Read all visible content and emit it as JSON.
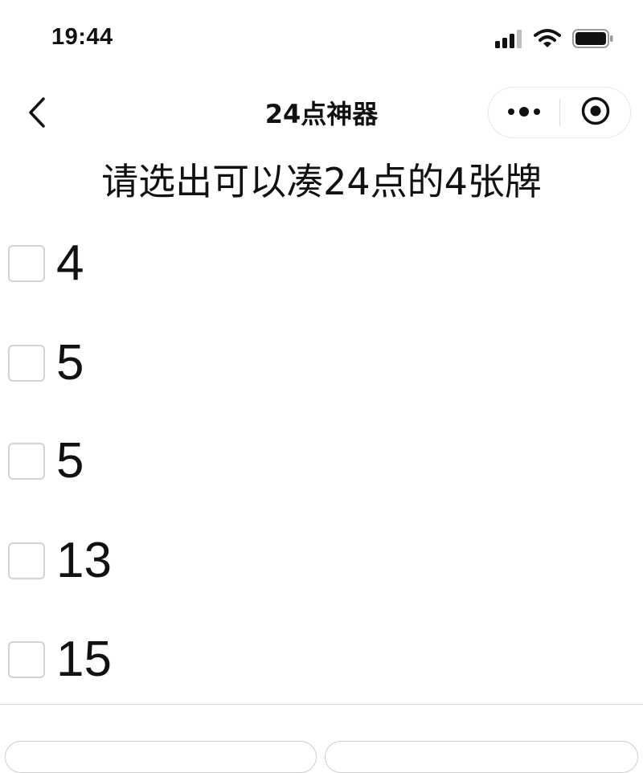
{
  "status_bar": {
    "time": "19:44",
    "icons": [
      "cellular-signal-icon",
      "wifi-icon",
      "battery-icon"
    ]
  },
  "nav": {
    "title": "24点神器",
    "back_icon": "chevron-left-icon",
    "more_icon": "more-dots-icon",
    "close_icon": "target-close-icon"
  },
  "prompt": "请选出可以凑24点的4张牌",
  "cards": [
    {
      "label": "4",
      "checked": false
    },
    {
      "label": "5",
      "checked": false
    },
    {
      "label": "5",
      "checked": false
    },
    {
      "label": "13",
      "checked": false
    },
    {
      "label": "15",
      "checked": false
    }
  ],
  "colors": {
    "background": "#ffffff",
    "text": "#111111",
    "checkbox_border": "#d3d3d3"
  }
}
